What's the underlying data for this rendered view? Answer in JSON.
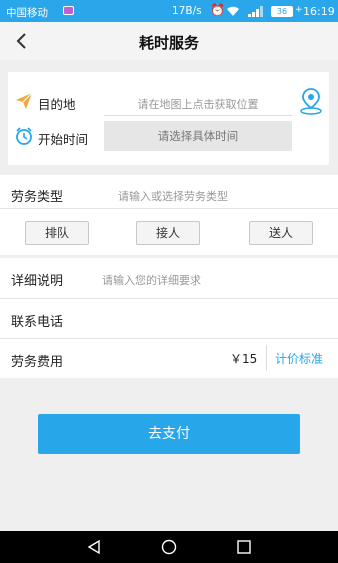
{
  "status_bar": {
    "carrier": "中国移动",
    "speed": "17B/s",
    "battery": "36",
    "time": "16:19"
  },
  "nav": {
    "title": "耗时服务",
    "back_icon": "chevron-left-icon"
  },
  "location": {
    "destination_label": "目的地",
    "destination_placeholder": "请在地图上点击获取位置",
    "start_time_label": "开始时间",
    "start_time_placeholder": "请选择具体时间"
  },
  "service_type": {
    "label": "劳务类型",
    "placeholder": "请输入或选择劳务类型",
    "options": [
      "排队",
      "接人",
      "送人"
    ]
  },
  "details": {
    "label": "详细说明",
    "placeholder": "请输入您的详细要求"
  },
  "phone": {
    "label": "联系电话"
  },
  "fee": {
    "label": "劳务费用",
    "value": "￥15",
    "standard_link": "计价标准"
  },
  "pay_button": "去支付",
  "colors": {
    "accent": "#27a6ea",
    "background": "#efefef"
  }
}
